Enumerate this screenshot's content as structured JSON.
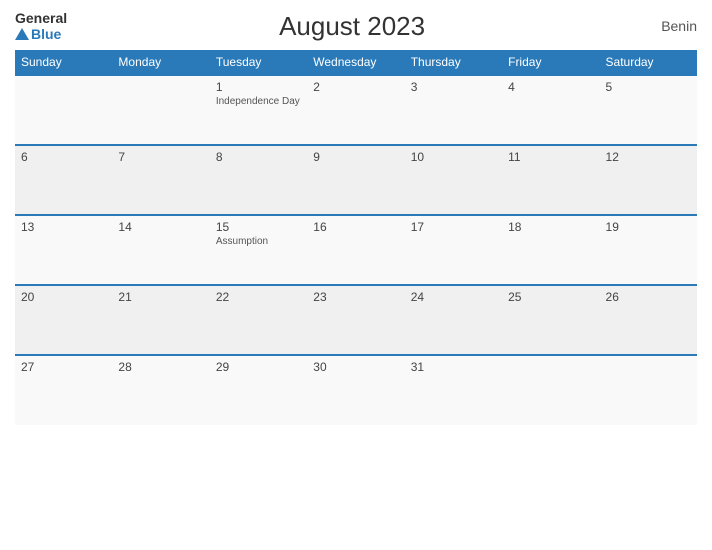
{
  "header": {
    "logo_general": "General",
    "logo_blue": "Blue",
    "title": "August 2023",
    "country": "Benin"
  },
  "weekdays": [
    "Sunday",
    "Monday",
    "Tuesday",
    "Wednesday",
    "Thursday",
    "Friday",
    "Saturday"
  ],
  "weeks": [
    [
      {
        "day": "",
        "holiday": ""
      },
      {
        "day": "",
        "holiday": ""
      },
      {
        "day": "1",
        "holiday": "Independence Day"
      },
      {
        "day": "2",
        "holiday": ""
      },
      {
        "day": "3",
        "holiday": ""
      },
      {
        "day": "4",
        "holiday": ""
      },
      {
        "day": "5",
        "holiday": ""
      }
    ],
    [
      {
        "day": "6",
        "holiday": ""
      },
      {
        "day": "7",
        "holiday": ""
      },
      {
        "day": "8",
        "holiday": ""
      },
      {
        "day": "9",
        "holiday": ""
      },
      {
        "day": "10",
        "holiday": ""
      },
      {
        "day": "11",
        "holiday": ""
      },
      {
        "day": "12",
        "holiday": ""
      }
    ],
    [
      {
        "day": "13",
        "holiday": ""
      },
      {
        "day": "14",
        "holiday": ""
      },
      {
        "day": "15",
        "holiday": "Assumption"
      },
      {
        "day": "16",
        "holiday": ""
      },
      {
        "day": "17",
        "holiday": ""
      },
      {
        "day": "18",
        "holiday": ""
      },
      {
        "day": "19",
        "holiday": ""
      }
    ],
    [
      {
        "day": "20",
        "holiday": ""
      },
      {
        "day": "21",
        "holiday": ""
      },
      {
        "day": "22",
        "holiday": ""
      },
      {
        "day": "23",
        "holiday": ""
      },
      {
        "day": "24",
        "holiday": ""
      },
      {
        "day": "25",
        "holiday": ""
      },
      {
        "day": "26",
        "holiday": ""
      }
    ],
    [
      {
        "day": "27",
        "holiday": ""
      },
      {
        "day": "28",
        "holiday": ""
      },
      {
        "day": "29",
        "holiday": ""
      },
      {
        "day": "30",
        "holiday": ""
      },
      {
        "day": "31",
        "holiday": ""
      },
      {
        "day": "",
        "holiday": ""
      },
      {
        "day": "",
        "holiday": ""
      }
    ]
  ]
}
